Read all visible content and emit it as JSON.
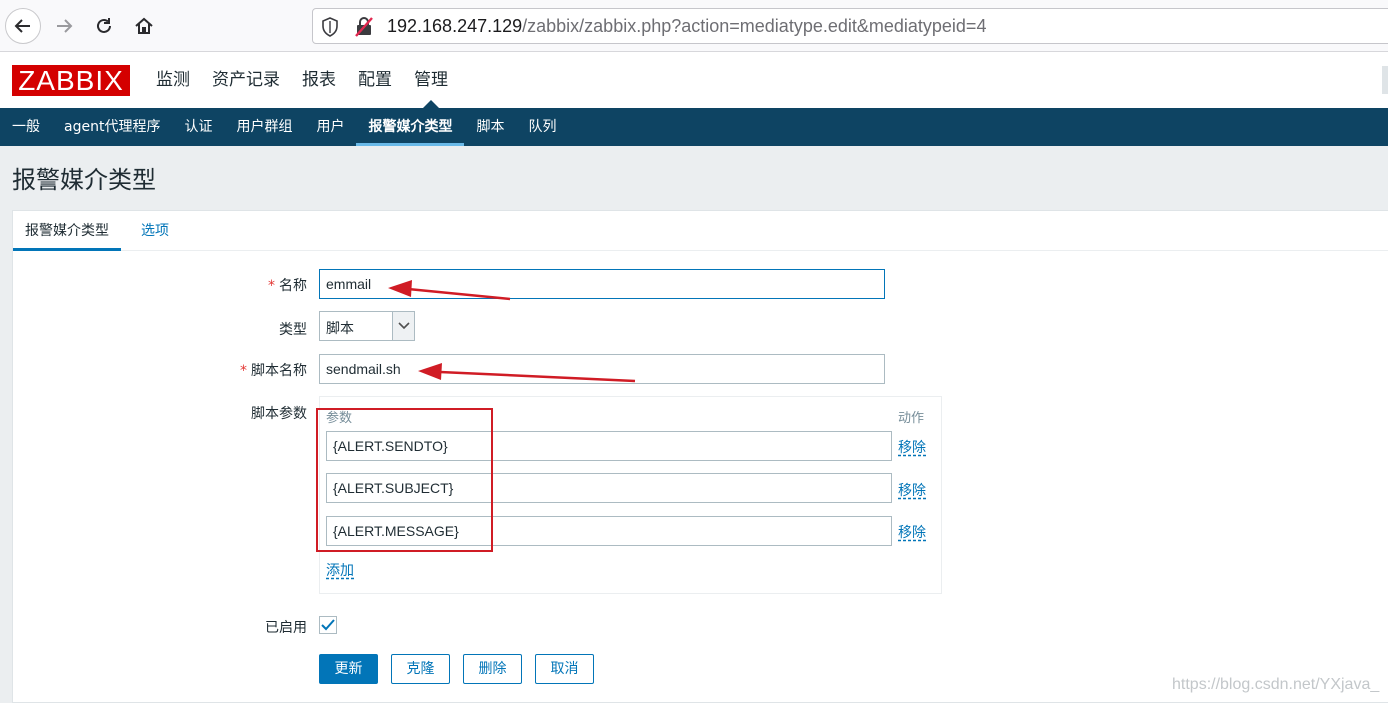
{
  "browser": {
    "url_host": "192.168.247.129",
    "url_path": "/zabbix/zabbix.php?action=mediatype.edit&mediatypeid=4"
  },
  "header": {
    "logo": "ZABBIX",
    "menu": [
      "监测",
      "资产记录",
      "报表",
      "配置",
      "管理"
    ],
    "active_menu": "管理"
  },
  "submenu": {
    "items": [
      "一般",
      "agent代理程序",
      "认证",
      "用户群组",
      "用户",
      "报警媒介类型",
      "脚本",
      "队列"
    ],
    "active": "报警媒介类型"
  },
  "page": {
    "title": "报警媒介类型"
  },
  "tabs": [
    "报警媒介类型",
    "选项"
  ],
  "form": {
    "name_label": "名称",
    "name_value": "emmail",
    "type_label": "类型",
    "type_value": "脚本",
    "script_name_label": "脚本名称",
    "script_name_value": "sendmail.sh",
    "params_label": "脚本参数",
    "params_header_param": "参数",
    "params_header_action": "动作",
    "params": [
      {
        "value": "{ALERT.SENDTO}",
        "remove": "移除"
      },
      {
        "value": "{ALERT.SUBJECT}",
        "remove": "移除"
      },
      {
        "value": "{ALERT.MESSAGE}",
        "remove": "移除"
      }
    ],
    "add_label": "添加",
    "enabled_label": "已启用",
    "enabled": true
  },
  "buttons": {
    "update": "更新",
    "clone": "克隆",
    "delete": "删除",
    "cancel": "取消"
  },
  "watermark": "https://blog.csdn.net/YXjava_"
}
